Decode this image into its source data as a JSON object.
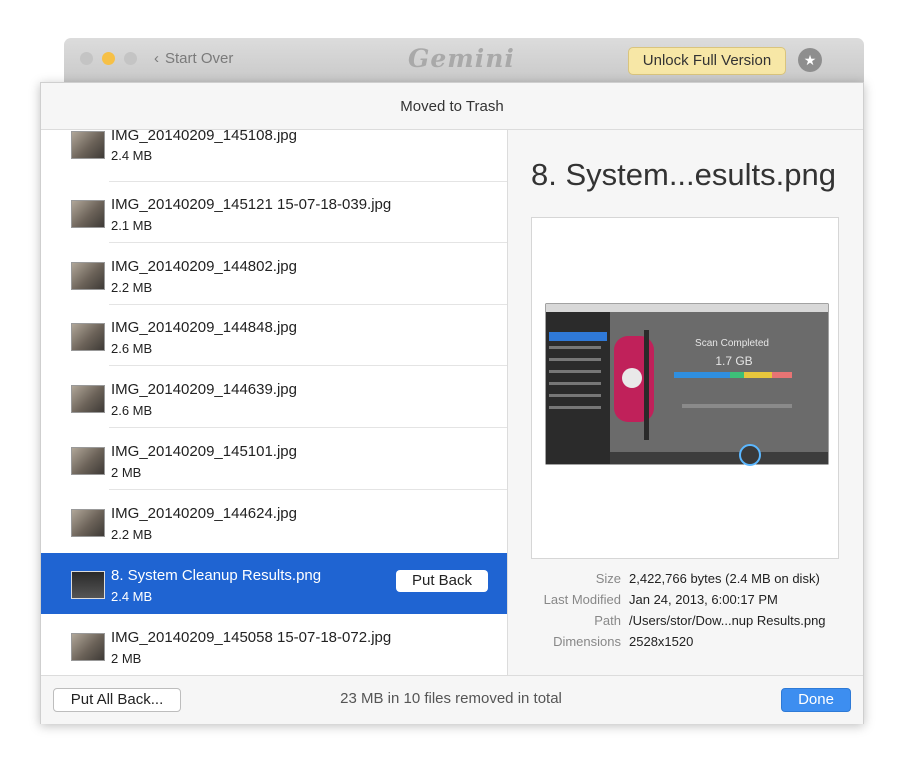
{
  "window": {
    "back_label": "Start Over",
    "logo": "Gemini",
    "unlock_label": "Unlock Full Version",
    "sheet_title": "Moved to Trash"
  },
  "files": [
    {
      "name": "IMG_20140209_145108.jpg",
      "size": "2.4 MB"
    },
    {
      "name": "IMG_20140209_145121 15-07-18-039.jpg",
      "size": "2.1 MB"
    },
    {
      "name": "IMG_20140209_144802.jpg",
      "size": "2.2 MB"
    },
    {
      "name": "IMG_20140209_144848.jpg",
      "size": "2.6 MB"
    },
    {
      "name": "IMG_20140209_144639.jpg",
      "size": "2.6 MB"
    },
    {
      "name": "IMG_20140209_145101.jpg",
      "size": "2 MB"
    },
    {
      "name": "IMG_20140209_144624.jpg",
      "size": "2.2 MB"
    },
    {
      "name": "8. System Cleanup Results.png",
      "size": "2.4 MB",
      "selected": true,
      "put_back_label": "Put Back"
    },
    {
      "name": "IMG_20140209_145058 15-07-18-072.jpg",
      "size": "2 MB"
    }
  ],
  "detail": {
    "title": "8. System...esults.png",
    "meta": [
      {
        "label": "Size",
        "value": "2,422,766 bytes (2.4 MB on disk)"
      },
      {
        "label": "Last Modified",
        "value": "Jan 24, 2013, 6:00:17 PM"
      },
      {
        "label": "Path",
        "value": "/Users/stor/Dow...nup Results.png"
      },
      {
        "label": "Dimensions",
        "value": "2528x1520"
      }
    ],
    "preview_texts": {
      "scan_completed": "Scan Completed",
      "amount": "1.7 GB"
    }
  },
  "footer": {
    "put_all_back_label": "Put All Back...",
    "summary": "23 MB in 10 files removed in total",
    "done_label": "Done"
  },
  "colors": {
    "selection": "#1f64d2",
    "done_button": "#3d8ef0",
    "unlock_button": "#f7e7a6"
  }
}
